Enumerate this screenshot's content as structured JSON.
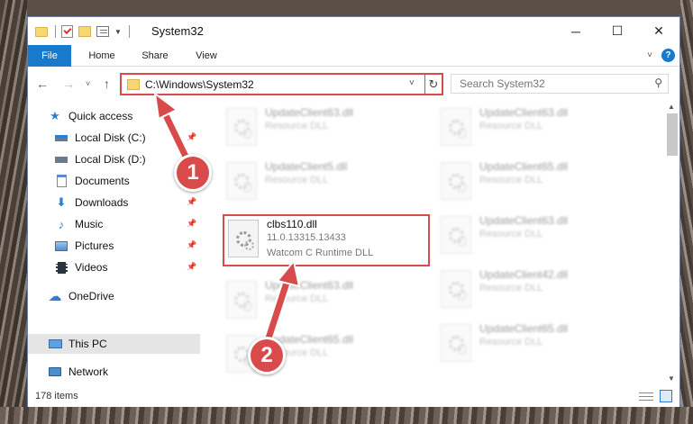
{
  "window": {
    "title": "System32",
    "buttons": {
      "minimize": "─",
      "maximize": "☐",
      "close": "✕"
    }
  },
  "ribbon": {
    "tabs": [
      "File",
      "Home",
      "Share",
      "View"
    ],
    "help": "?"
  },
  "nav": {
    "address": "C:\\Windows\\System32",
    "search_placeholder": "Search System32"
  },
  "sidebar": {
    "items": [
      {
        "label": "Quick access",
        "icon": "star-icon"
      },
      {
        "label": "Local Disk (C:)",
        "icon": "drive-icon",
        "pinned": true
      },
      {
        "label": "Local Disk (D:)",
        "icon": "drive-icon"
      },
      {
        "label": "Documents",
        "icon": "documents-icon"
      },
      {
        "label": "Downloads",
        "icon": "download-icon",
        "pinned": true
      },
      {
        "label": "Music",
        "icon": "music-icon",
        "pinned": true
      },
      {
        "label": "Pictures",
        "icon": "pictures-icon",
        "pinned": true
      },
      {
        "label": "Videos",
        "icon": "videos-icon",
        "pinned": true
      },
      {
        "label": "OneDrive",
        "icon": "cloud-icon"
      },
      {
        "label": "This PC",
        "icon": "computer-icon",
        "selected": true
      },
      {
        "label": "Network",
        "icon": "network-icon"
      }
    ]
  },
  "files": {
    "left": [
      {
        "name": "UpdateClient63.dll",
        "sub1": "Resource DLL"
      },
      {
        "name": "UpdateClient5.dll",
        "sub1": "Resource DLL"
      },
      {
        "name": "clbs110.dll",
        "sub1": "11.0.13315.13433",
        "sub2": "Watcom C Runtime DLL"
      },
      {
        "name": "UpdateClient63.dll",
        "sub1": "Resource DLL"
      },
      {
        "name": "UpdateClient65.dll",
        "sub1": "Resource DLL"
      }
    ],
    "right": [
      {
        "name": "UpdateClient63.dll",
        "sub1": "Resource DLL"
      },
      {
        "name": "UpdateClient65.dll",
        "sub1": "Resource DLL"
      },
      {
        "name": "UpdateClient63.dll",
        "sub1": "Resource DLL"
      },
      {
        "name": "UpdateClient42.dll",
        "sub1": "Resource DLL"
      },
      {
        "name": "UpdateClient65.dll",
        "sub1": "Resource DLL"
      }
    ]
  },
  "status": {
    "item_count": "178 items"
  },
  "annotations": {
    "step1": "1",
    "step2": "2",
    "color": "#d94b4b"
  }
}
